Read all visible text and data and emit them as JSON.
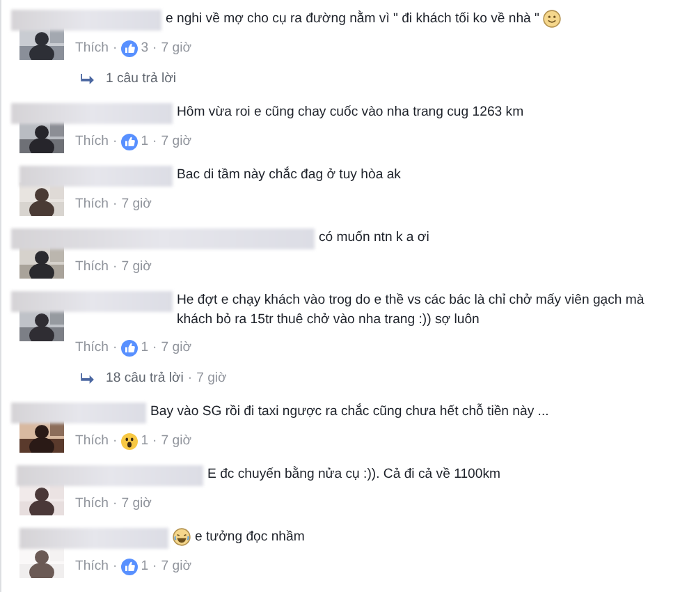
{
  "separator": "·",
  "comments": [
    {
      "text": "e nghi về mợ cho cụ ra đường nằm vì \" đi khách tối ko về nhà \"",
      "emoji": {
        "kind": "smile",
        "after_text": true
      },
      "like_label": "Thích",
      "reaction": {
        "kind": "like",
        "count": "3"
      },
      "time": "7 giờ",
      "reply": {
        "label": "1 câu trả lời"
      }
    },
    {
      "text": "Hôm vừa roi e cũng chay cuốc vào nha trang cug 1263 km",
      "like_label": "Thích",
      "reaction": {
        "kind": "like",
        "count": "1"
      },
      "time": "7 giờ"
    },
    {
      "text": "Bac di tầm này chắc đag ở tuy hòa ak",
      "like_label": "Thích",
      "time": "7 giờ"
    },
    {
      "text": "có muốn ntn k a ơi",
      "like_label": "Thích",
      "time": "7 giờ"
    },
    {
      "text": "He đợt e chạy khách vào trog do e thề vs các bác là chỉ chở mấy viên gạch mà khách bỏ ra 15tr thuê chở vào nha trang :)) sợ luôn",
      "like_label": "Thích",
      "reaction": {
        "kind": "like",
        "count": "1"
      },
      "time": "7 giờ",
      "reply": {
        "label": "18 câu trả lời",
        "time": "7 giờ"
      }
    },
    {
      "text": "Bay vào SG rồi đi taxi ngược ra chắc cũng chưa hết chỗ tiền này ...",
      "like_label": "Thích",
      "reaction": {
        "kind": "wow",
        "count": "1"
      },
      "time": "7 giờ"
    },
    {
      "text": "E đc chuyến bằng nửa cụ :)). Cả đi cả về 1100km",
      "like_label": "Thích",
      "time": "7 giờ"
    },
    {
      "text": "e tưởng đọc nhầm",
      "emoji": {
        "kind": "haha",
        "after_text": false
      },
      "like_label": "Thích",
      "reaction": {
        "kind": "like",
        "count": "1"
      },
      "time": "7 giờ"
    }
  ]
}
